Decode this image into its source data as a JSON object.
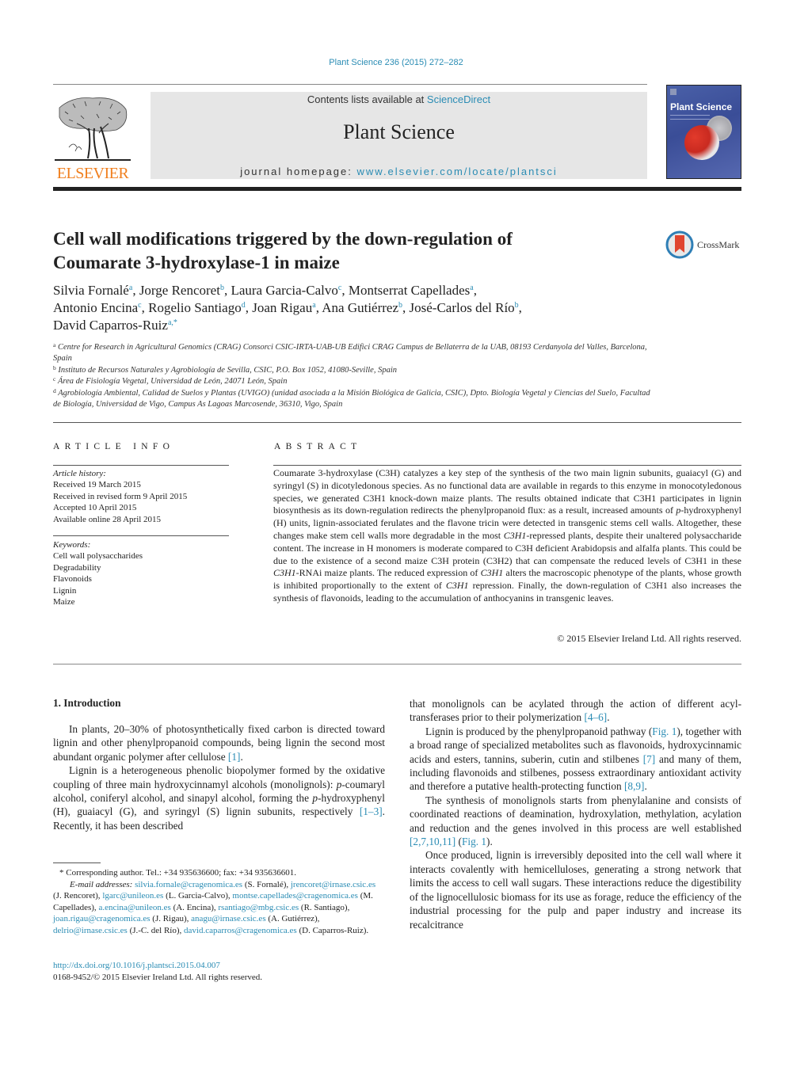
{
  "header": {
    "citation": "Plant Science 236 (2015) 272–282",
    "contents_prefix": "Contents lists available at ",
    "contents_link": "ScienceDirect",
    "journal_title": "Plant Science",
    "homepage_prefix": "journal homepage: ",
    "homepage_link": "www.elsevier.com/locate/plantsci",
    "publisher_logo_text": "ELSEVIER",
    "cover_title": "Plant Science",
    "crossmark_label": "CrossMark"
  },
  "article": {
    "title_line1": "Cell wall modifications triggered by the down-regulation of",
    "title_line2": "Coumarate 3-hydroxylase-1 in maize",
    "authors": [
      {
        "name": "Silvia Fornalé",
        "aff": "a"
      },
      {
        "name": "Jorge Rencoret",
        "aff": "b"
      },
      {
        "name": "Laura Garcia-Calvo",
        "aff": "c"
      },
      {
        "name": "Montserrat Capellades",
        "aff": "a"
      },
      {
        "name": "Antonio Encina",
        "aff": "c"
      },
      {
        "name": "Rogelio Santiago",
        "aff": "d"
      },
      {
        "name": "Joan Rigau",
        "aff": "a"
      },
      {
        "name": "Ana Gutiérrez",
        "aff": "b"
      },
      {
        "name": "José-Carlos del Río",
        "aff": "b"
      },
      {
        "name": "David Caparros-Ruiz",
        "aff": "a,*"
      }
    ],
    "affiliations": [
      {
        "key": "a",
        "text": "Centre for Research in Agricultural Genomics (CRAG) Consorci CSIC-IRTA-UAB-UB Edifici CRAG Campus de Bellaterra de la UAB, 08193 Cerdanyola del Valles, Barcelona, Spain"
      },
      {
        "key": "b",
        "text": "Instituto de Recursos Naturales y Agrobiología de Sevilla, CSIC, P.O. Box 1052, 41080-Seville, Spain"
      },
      {
        "key": "c",
        "text": "Área de Fisiología Vegetal, Universidad de León, 24071 León, Spain"
      },
      {
        "key": "d",
        "text": "Agrobiología Ambiental, Calidad de Suelos y Plantas (UVIGO) (unidad asociada a la Misión Biológica de Galicia, CSIC), Dpto. Biología Vegetal y Ciencias del Suelo, Facultad de Biología, Universidad de Vigo, Campus As Lagoas Marcosende, 36310, Vigo, Spain"
      }
    ]
  },
  "article_info": {
    "label": "ARTICLE INFO",
    "history_heading": "Article history:",
    "history": [
      "Received 19 March 2015",
      "Received in revised form 9 April 2015",
      "Accepted 10 April 2015",
      "Available online 28 April 2015"
    ],
    "keywords_heading": "Keywords:",
    "keywords": [
      "Cell wall polysaccharides",
      "Degradability",
      "Flavonoids",
      "Lignin",
      "Maize"
    ]
  },
  "abstract": {
    "label": "ABSTRACT",
    "segments": [
      {
        "t": "Coumarate 3-hydroxylase (C3H) catalyzes a key step of the synthesis of the two main lignin subunits, guaiacyl (G) and syringyl (S) in dicotyledonous species. As no functional data are available in regards to this enzyme in monocotyledonous species, we generated C3H1 knock-down maize plants. The results obtained indicate that C3H1 participates in lignin biosynthesis as its down-regulation redirects the phenylpropanoid flux: as a result, increased amounts of "
      },
      {
        "t": "p",
        "i": true
      },
      {
        "t": "-hydroxyphenyl (H) units, lignin-associated ferulates and the flavone tricin were detected in transgenic stems cell walls. Altogether, these changes make stem cell walls more degradable in the most "
      },
      {
        "t": "C3H1",
        "i": true
      },
      {
        "t": "-repressed plants, despite their unaltered polysaccharide content. The increase in H monomers is moderate compared to C3H deficient Arabidopsis and alfalfa plants. This could be due to the existence of a second maize C3H protein (C3H2) that can compensate the reduced levels of C3H1 in these "
      },
      {
        "t": "C3H1",
        "i": true
      },
      {
        "t": "-RNAi maize plants. The reduced expression of "
      },
      {
        "t": "C3H1",
        "i": true
      },
      {
        "t": " alters the macroscopic phenotype of the plants, whose growth is inhibited proportionally to the extent of "
      },
      {
        "t": "C3H1",
        "i": true
      },
      {
        "t": " repression. Finally, the down-regulation of C3H1 also increases the synthesis of flavonoids, leading to the accumulation of anthocyanins in transgenic leaves."
      }
    ],
    "copyright": "© 2015 Elsevier Ireland Ltd. All rights reserved."
  },
  "introduction": {
    "heading": "1.  Introduction",
    "left_paragraphs": [
      [
        {
          "t": "In plants, 20–30% of photosynthetically fixed carbon is directed toward lignin and other phenylpropanoid compounds, being lignin the second most abundant organic polymer after cellulose "
        },
        {
          "t": "[1]",
          "l": true
        },
        {
          "t": "."
        }
      ],
      [
        {
          "t": "Lignin is a heterogeneous phenolic biopolymer formed by the oxidative coupling of three main hydroxycinnamyl alcohols (monolignols): "
        },
        {
          "t": "p",
          "i": true
        },
        {
          "t": "-coumaryl alcohol, coniferyl alcohol, and sinapyl alcohol, forming the "
        },
        {
          "t": "p",
          "i": true
        },
        {
          "t": "-hydroxyphenyl (H), guaiacyl (G), and syringyl (S) lignin subunits, respectively "
        },
        {
          "t": "[1–3]",
          "l": true
        },
        {
          "t": ". Recently, it has been described"
        }
      ]
    ],
    "right_paragraphs": [
      [
        {
          "t": "that monolignols can be acylated through the action of different acyl-transferases prior to their polymerization "
        },
        {
          "t": "[4–6]",
          "l": true
        },
        {
          "t": "."
        }
      ],
      [
        {
          "t": "Lignin is produced by the phenylpropanoid pathway ("
        },
        {
          "t": "Fig. 1",
          "l": true
        },
        {
          "t": "), together with a broad range of specialized metabolites such as flavonoids, hydroxycinnamic acids and esters, tannins, suberin, cutin and stilbenes "
        },
        {
          "t": "[7]",
          "l": true
        },
        {
          "t": " and many of them, including flavonoids and stilbenes, possess extraordinary antioxidant activity and therefore a putative health-protecting function "
        },
        {
          "t": "[8,9]",
          "l": true
        },
        {
          "t": "."
        }
      ],
      [
        {
          "t": "The synthesis of monolignols starts from phenylalanine and consists of coordinated reactions of deamination, hydroxylation, methylation, acylation and reduction and the genes involved in this process are well established "
        },
        {
          "t": "[2,7,10,11]",
          "l": true
        },
        {
          "t": " ("
        },
        {
          "t": "Fig. 1",
          "l": true
        },
        {
          "t": ")."
        }
      ],
      [
        {
          "t": "Once produced, lignin is irreversibly deposited into the cell wall where it interacts covalently with hemicelluloses, generating a strong network that limits the access to cell wall sugars. These interactions reduce the digestibility of the lignocellulosic biomass for its use as forage, reduce the efficiency of the industrial processing for the pulp and paper industry and increase its recalcitrance"
        }
      ]
    ]
  },
  "footnote": {
    "corresponding": "*  Corresponding author. Tel.: +34 935636600; fax: +34 935636601.",
    "email_heading": "E-mail addresses: ",
    "emails": [
      {
        "email": "silvia.fornale@cragenomica.es",
        "who": " (S. Fornalé), "
      },
      {
        "email": "jrencoret@irnase.csic.es",
        "who": " (J. Rencoret), "
      },
      {
        "email": "lgarc@unileon.es",
        "who": " (L. Garcia-Calvo), "
      },
      {
        "email": "montse.capellades@cragenomica.es",
        "who": " (M. Capellades), "
      },
      {
        "email": "a.encina@unileon.es",
        "who": " (A. Encina), "
      },
      {
        "email": "rsantiago@mbg.csic.es",
        "who": " (R. Santiago), "
      },
      {
        "email": "joan.rigau@cragenomica.es",
        "who": " (J. Rigau), "
      },
      {
        "email": "anagu@irnase.csic.es",
        "who": " (A. Gutiérrez), "
      },
      {
        "email": "delrio@irnase.csic.es",
        "who": " (J.-C. del Río), "
      },
      {
        "email": "david.caparros@cragenomica.es",
        "who": " (D. Caparros-Ruiz)."
      }
    ],
    "doi": "http://dx.doi.org/10.1016/j.plantsci.2015.04.007",
    "issn_line": "0168-9452/© 2015 Elsevier Ireland Ltd. All rights reserved."
  },
  "colors": {
    "link": "#2a8cb4",
    "elsevier_orange": "#f07f1e",
    "masthead_bg": "#e6e6e6"
  }
}
